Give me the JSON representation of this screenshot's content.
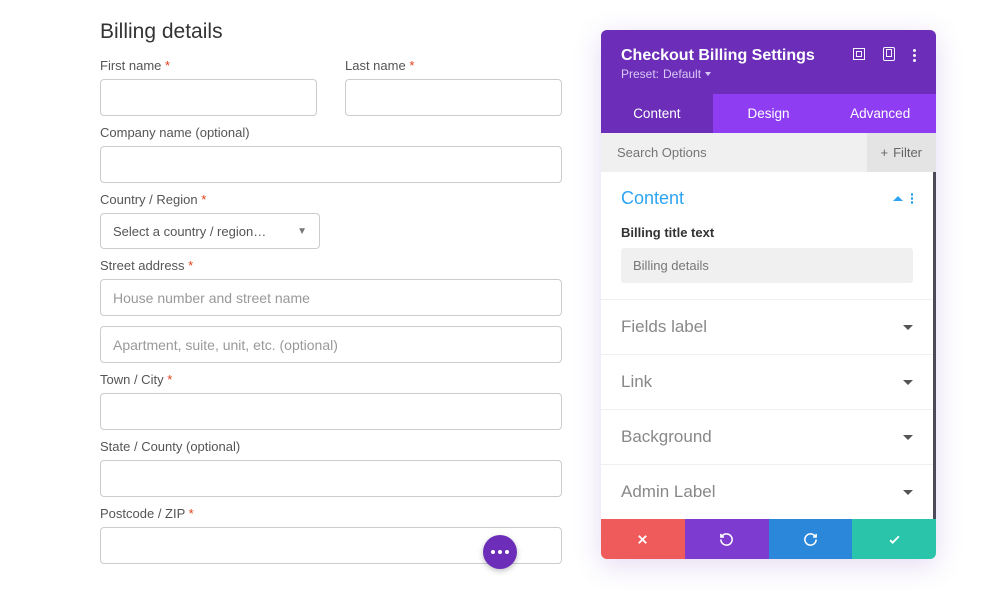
{
  "form": {
    "title": "Billing details",
    "labels": {
      "first_name": "First name",
      "last_name": "Last name",
      "company": "Company name (optional)",
      "country": "Country / Region",
      "street": "Street address",
      "town": "Town / City",
      "state": "State / County (optional)",
      "postcode": "Postcode / ZIP"
    },
    "placeholders": {
      "country_select": "Select a country / region…",
      "street1": "House number and street name",
      "street2": "Apartment, suite, unit, etc. (optional)"
    }
  },
  "panel": {
    "title": "Checkout Billing Settings",
    "preset_label": "Preset:",
    "preset_value": "Default",
    "tabs": {
      "content": "Content",
      "design": "Design",
      "advanced": "Advanced"
    },
    "search_placeholder": "Search Options",
    "filter_label": "Filter",
    "section_content": "Content",
    "billing_title_label": "Billing title text",
    "billing_title_value": "Billing details",
    "accordions": {
      "fields_label": "Fields label",
      "link": "Link",
      "background": "Background",
      "admin_label": "Admin Label"
    }
  }
}
